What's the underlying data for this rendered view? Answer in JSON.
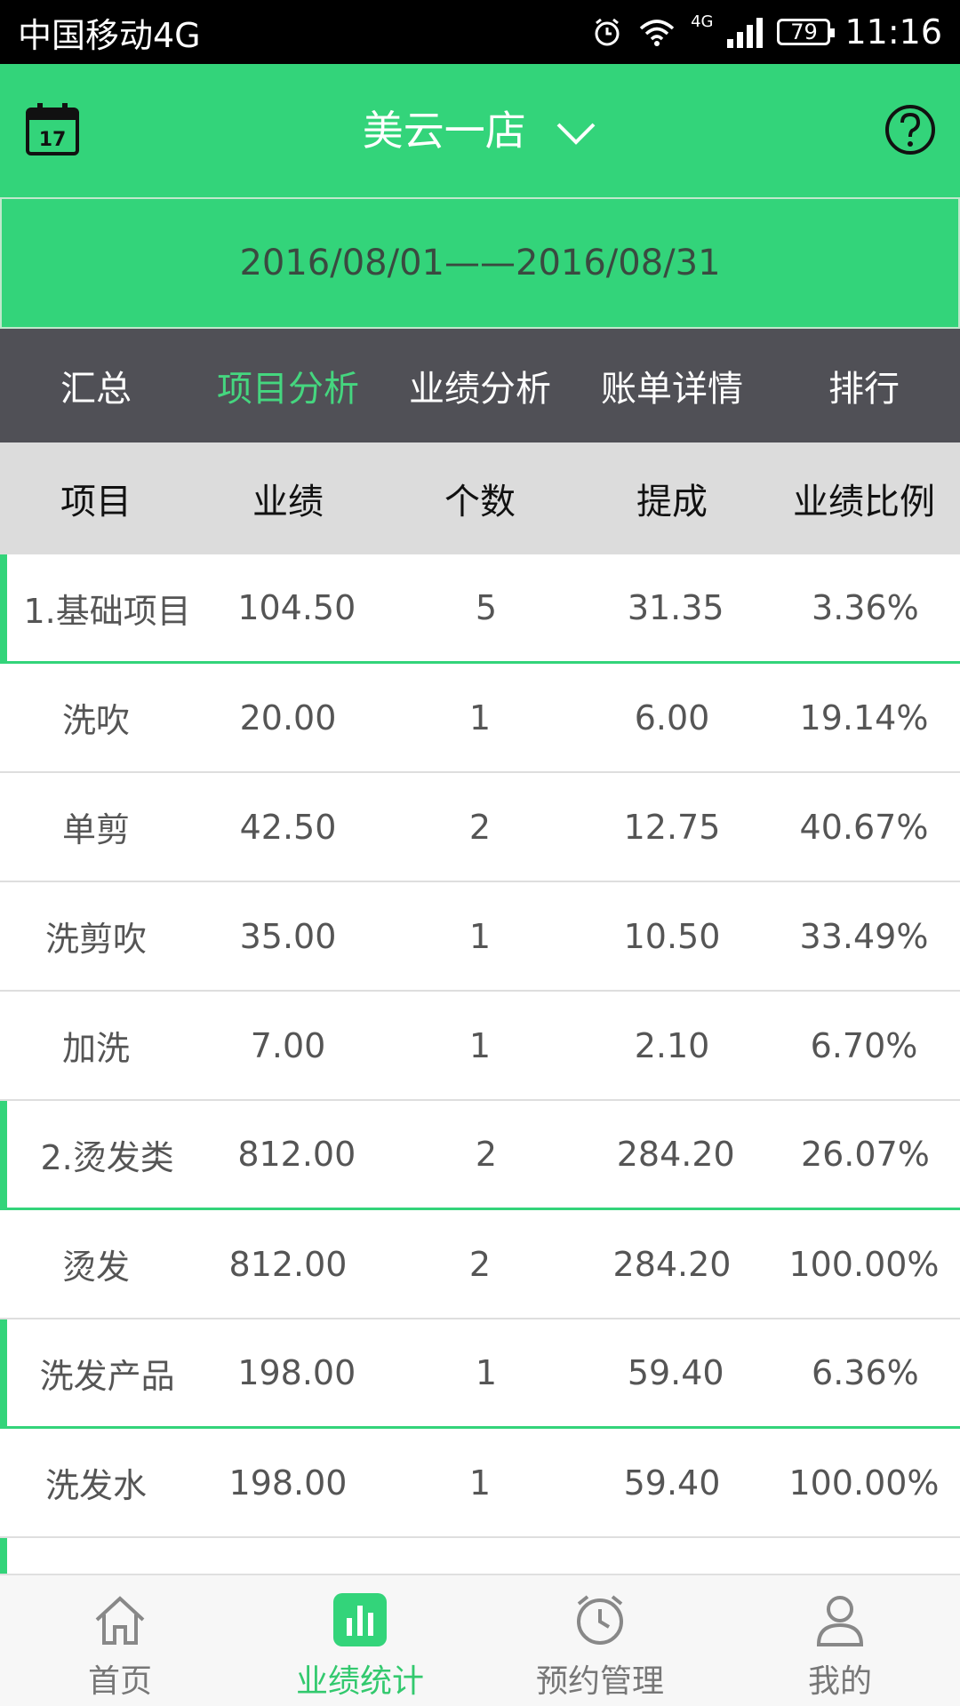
{
  "status_bar": {
    "carrier": "中国移动4G",
    "network_badge": "4G",
    "battery": "79",
    "time": "11:16"
  },
  "header": {
    "calendar_day": "17",
    "store_name": "美云一店",
    "icons": {
      "left": "calendar-icon",
      "right": "help-icon",
      "dropdown": "chevron-down-icon"
    },
    "accent_color": "#33d47a"
  },
  "date_range": "2016/08/01——2016/08/31",
  "tabs": [
    {
      "label": "汇总"
    },
    {
      "label": "项目分析",
      "active": true
    },
    {
      "label": "业绩分析"
    },
    {
      "label": "账单详情"
    },
    {
      "label": "排行"
    }
  ],
  "table": {
    "headers": [
      "项目",
      "业绩",
      "个数",
      "提成",
      "业绩比例"
    ],
    "rows": [
      {
        "name": "1.基础项目",
        "sales": "104.50",
        "count": "5",
        "commission": "31.35",
        "ratio": "3.36%"
      },
      {
        "name": "洗吹",
        "sales": "20.00",
        "count": "1",
        "commission": "6.00",
        "ratio": "19.14%"
      },
      {
        "name": "单剪",
        "sales": "42.50",
        "count": "2",
        "commission": "12.75",
        "ratio": "40.67%"
      },
      {
        "name": "洗剪吹",
        "sales": "35.00",
        "count": "1",
        "commission": "10.50",
        "ratio": "33.49%"
      },
      {
        "name": "加洗",
        "sales": "7.00",
        "count": "1",
        "commission": "2.10",
        "ratio": "6.70%"
      },
      {
        "name": "2.烫发类",
        "sales": "812.00",
        "count": "2",
        "commission": "284.20",
        "ratio": "26.07%"
      },
      {
        "name": "烫发",
        "sales": "812.00",
        "count": "2",
        "commission": "284.20",
        "ratio": "100.00%"
      },
      {
        "name": "洗发产品",
        "sales": "198.00",
        "count": "1",
        "commission": "59.40",
        "ratio": "6.36%"
      },
      {
        "name": "洗发水",
        "sales": "198.00",
        "count": "1",
        "commission": "59.40",
        "ratio": "100.00%"
      }
    ]
  },
  "bottom_nav": [
    {
      "label": "首页",
      "icon": "home-icon"
    },
    {
      "label": "业绩统计",
      "icon": "bar-chart-icon",
      "active": true
    },
    {
      "label": "预约管理",
      "icon": "alarm-clock-icon"
    },
    {
      "label": "我的",
      "icon": "user-icon"
    }
  ]
}
